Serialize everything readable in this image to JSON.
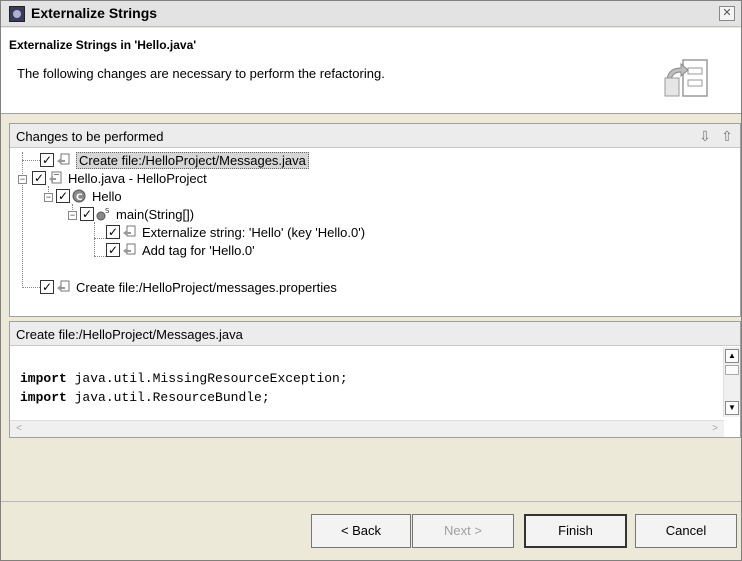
{
  "window": {
    "title": "Externalize Strings"
  },
  "header": {
    "title": "Externalize Strings in 'Hello.java'",
    "description": "The following changes are necessary to perform the refactoring."
  },
  "changes": {
    "heading": "Changes to be performed",
    "items": [
      {
        "label": "Create file:/HelloProject/Messages.java",
        "checked": true,
        "icon": "file-change-icon"
      },
      {
        "label": "Hello.java - HelloProject",
        "checked": true,
        "icon": "java-file-icon"
      },
      {
        "label": "Hello",
        "checked": true,
        "icon": "class-icon"
      },
      {
        "label": "main(String[])",
        "checked": true,
        "icon": "method-icon"
      },
      {
        "label": "Externalize string: 'Hello' (key 'Hello.0')",
        "checked": true,
        "icon": "text-change-icon"
      },
      {
        "label": "Add tag for 'Hello.0'",
        "checked": true,
        "icon": "text-change-icon"
      },
      {
        "label": "Create file:/HelloProject/messages.properties",
        "checked": true,
        "icon": "file-change-icon"
      }
    ]
  },
  "preview": {
    "heading": "Create file:/HelloProject/Messages.java",
    "code": [
      {
        "keyword": "import",
        "rest": " java.util.MissingResourceException;"
      },
      {
        "keyword": "import",
        "rest": " java.util.ResourceBundle;"
      }
    ]
  },
  "buttons": {
    "back": "< Back",
    "next": "Next >",
    "finish": "Finish",
    "cancel": "Cancel"
  }
}
